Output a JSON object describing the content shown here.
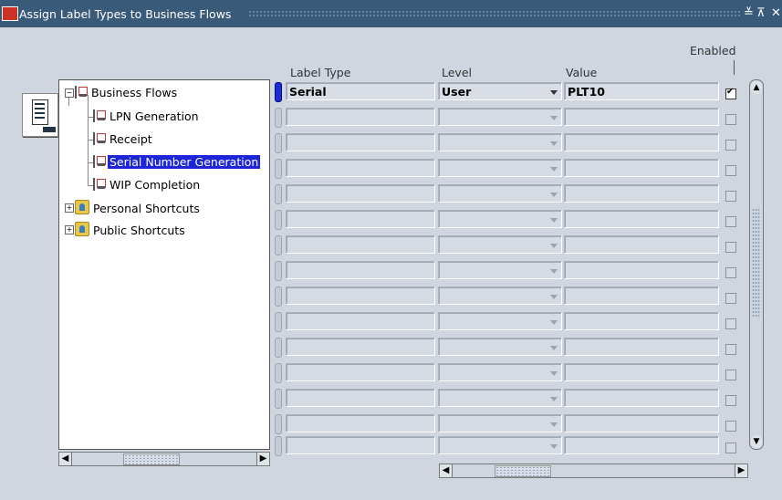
{
  "window": {
    "title": "Assign Label Types to Business Flows",
    "buttons": [
      "≚",
      "⊼",
      "✕"
    ]
  },
  "tree": {
    "nodes": [
      {
        "label": "Business Flows",
        "expanded": true
      },
      {
        "label": "LPN Generation"
      },
      {
        "label": "Receipt"
      },
      {
        "label": "Serial Number Generation",
        "selected": true
      },
      {
        "label": "WIP Completion"
      },
      {
        "label": "Personal Shortcuts",
        "expanded": false
      },
      {
        "label": "Public Shortcuts",
        "expanded": false
      }
    ]
  },
  "grid": {
    "headers": {
      "label_type": "Label Type",
      "level": "Level",
      "value": "Value",
      "enabled": "Enabled"
    },
    "rows": [
      {
        "label_type": "Serial",
        "level": "User",
        "value": "PLT10",
        "enabled": true
      },
      {
        "label_type": "",
        "level": "",
        "value": "",
        "enabled": false
      },
      {
        "label_type": "",
        "level": "",
        "value": "",
        "enabled": false
      },
      {
        "label_type": "",
        "level": "",
        "value": "",
        "enabled": false
      },
      {
        "label_type": "",
        "level": "",
        "value": "",
        "enabled": false
      },
      {
        "label_type": "",
        "level": "",
        "value": "",
        "enabled": false
      },
      {
        "label_type": "",
        "level": "",
        "value": "",
        "enabled": false
      },
      {
        "label_type": "",
        "level": "",
        "value": "",
        "enabled": false
      },
      {
        "label_type": "",
        "level": "",
        "value": "",
        "enabled": false
      },
      {
        "label_type": "",
        "level": "",
        "value": "",
        "enabled": false
      },
      {
        "label_type": "",
        "level": "",
        "value": "",
        "enabled": false
      },
      {
        "label_type": "",
        "level": "",
        "value": "",
        "enabled": false
      },
      {
        "label_type": "",
        "level": "",
        "value": "",
        "enabled": false
      },
      {
        "label_type": "",
        "level": "",
        "value": "",
        "enabled": false
      },
      {
        "label_type": "",
        "level": "",
        "value": "",
        "enabled": false
      }
    ]
  },
  "colors": {
    "titlebar": "#3a5a7a",
    "selection": "#1c25d8",
    "background": "#cfd6e0"
  },
  "icons": {
    "flow_node": "business-flow-icon",
    "folder_node": "shortcut-folder-icon",
    "side_tool": "document-list-icon"
  }
}
